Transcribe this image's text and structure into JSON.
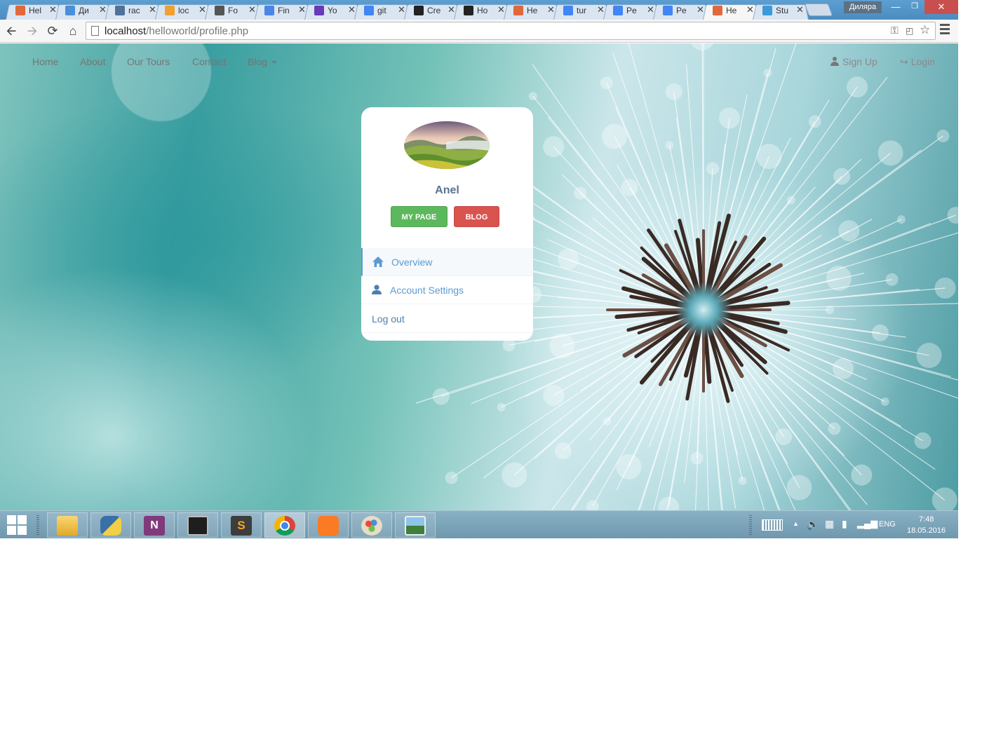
{
  "browser": {
    "tabs": [
      {
        "title": "Hel",
        "favicon_color": "#e1683b",
        "active": false
      },
      {
        "title": "Ди",
        "favicon_color": "#4a8fd8",
        "active": false
      },
      {
        "title": "rac",
        "favicon_color": "#507299",
        "active": false
      },
      {
        "title": "loc",
        "favicon_color": "#f0a030",
        "active": false
      },
      {
        "title": "Fo",
        "favicon_color": "#555555",
        "active": false
      },
      {
        "title": "Fin",
        "favicon_color": "#4a86e8",
        "active": false
      },
      {
        "title": "Yo",
        "favicon_color": "#673ab7",
        "active": false
      },
      {
        "title": "git",
        "favicon_color": "#4285f4",
        "active": false
      },
      {
        "title": "Cre",
        "favicon_color": "#222222",
        "active": false
      },
      {
        "title": "Ho",
        "favicon_color": "#222222",
        "active": false
      },
      {
        "title": "He",
        "favicon_color": "#e1683b",
        "active": false
      },
      {
        "title": "tur",
        "favicon_color": "#4285f4",
        "active": false
      },
      {
        "title": "Pe",
        "favicon_color": "#4285f4",
        "active": false
      },
      {
        "title": "Pe",
        "favicon_color": "#4285f4",
        "active": false
      },
      {
        "title": "He",
        "favicon_color": "#e1683b",
        "active": true
      },
      {
        "title": "Stu",
        "favicon_color": "#3b9ad9",
        "active": false
      }
    ],
    "user_chip": "Диляра",
    "address": {
      "host": "localhost",
      "path": "/helloworld/profile.php"
    }
  },
  "site": {
    "nav_left": [
      "Home",
      "About",
      "Our Tours",
      "Contact",
      "Blog"
    ],
    "nav_right": {
      "signup": "Sign Up",
      "login": "Login"
    }
  },
  "profile": {
    "name": "Anel",
    "buttons": {
      "my_page": "MY PAGE",
      "blog": "BLOG"
    },
    "menu": {
      "overview": "Overview",
      "account_settings": "Account Settings",
      "logout": "Log out"
    }
  },
  "taskbar": {
    "apps": [
      "file-explorer",
      "python",
      "onenote",
      "terminal",
      "sublime-text",
      "chrome",
      "xampp",
      "paint",
      "photo-viewer"
    ],
    "active_app": "chrome",
    "language": "ENG",
    "time": "7:48",
    "date": "18.05.2016"
  },
  "colors": {
    "mypage_green": "#5cb85c",
    "blog_red": "#d9534f",
    "menu_blue": "#5b9bd1",
    "name_color": "#5a7391"
  }
}
